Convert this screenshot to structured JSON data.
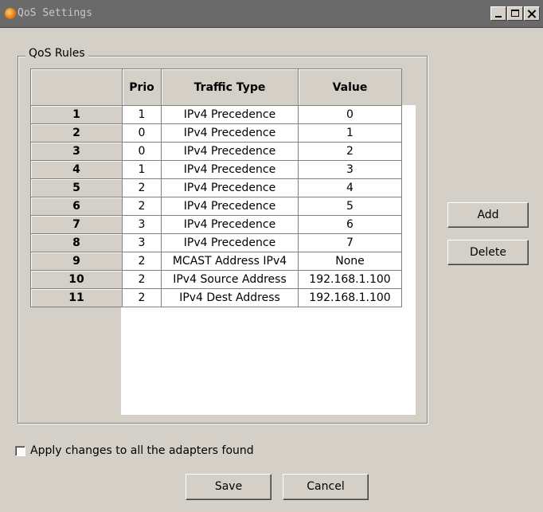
{
  "window": {
    "title": "QoS Settings"
  },
  "group": {
    "legend": "QoS Rules"
  },
  "table": {
    "columns": [
      "",
      "Prio",
      "Traffic Type",
      "Value"
    ],
    "rows": [
      {
        "num": "1",
        "prio": "1",
        "type": "IPv4 Precedence",
        "value": "0"
      },
      {
        "num": "2",
        "prio": "0",
        "type": "IPv4 Precedence",
        "value": "1"
      },
      {
        "num": "3",
        "prio": "0",
        "type": "IPv4 Precedence",
        "value": "2"
      },
      {
        "num": "4",
        "prio": "1",
        "type": "IPv4 Precedence",
        "value": "3"
      },
      {
        "num": "5",
        "prio": "2",
        "type": "IPv4 Precedence",
        "value": "4"
      },
      {
        "num": "6",
        "prio": "2",
        "type": "IPv4 Precedence",
        "value": "5"
      },
      {
        "num": "7",
        "prio": "3",
        "type": "IPv4 Precedence",
        "value": "6"
      },
      {
        "num": "8",
        "prio": "3",
        "type": "IPv4 Precedence",
        "value": "7"
      },
      {
        "num": "9",
        "prio": "2",
        "type": "MCAST Address IPv4",
        "value": "None"
      },
      {
        "num": "10",
        "prio": "2",
        "type": "IPv4 Source Address",
        "value": "192.168.1.100"
      },
      {
        "num": "11",
        "prio": "2",
        "type": "IPv4 Dest Address",
        "value": "192.168.1.100"
      }
    ]
  },
  "buttons": {
    "add": "Add",
    "delete": "Delete",
    "save": "Save",
    "cancel": "Cancel"
  },
  "checkbox": {
    "label": "Apply changes to all the adapters found",
    "checked": false
  },
  "icons": {
    "app": "app-logo-icon",
    "minimize": "minimize-icon",
    "maximize": "maximize-icon",
    "close": "close-icon"
  }
}
